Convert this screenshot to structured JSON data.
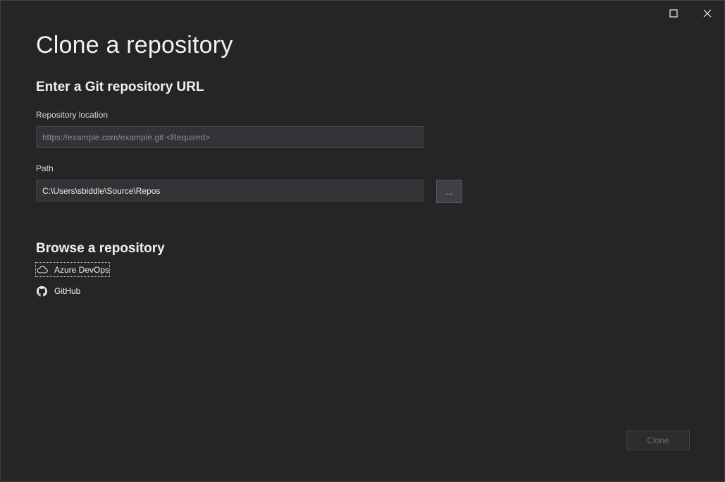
{
  "dialog": {
    "title": "Clone a repository"
  },
  "url_section": {
    "heading": "Enter a Git repository URL",
    "repo_location": {
      "label": "Repository location",
      "placeholder": "https://example.com/example.git <Required>",
      "value": ""
    },
    "path": {
      "label": "Path",
      "value": "C:\\Users\\sbiddle\\Source\\Repos",
      "browse_label": "..."
    }
  },
  "browse_section": {
    "heading": "Browse a repository",
    "providers": [
      {
        "label": "Azure DevOps",
        "icon": "cloud-icon"
      },
      {
        "label": "GitHub",
        "icon": "github-icon"
      }
    ]
  },
  "footer": {
    "clone_label": "Clone"
  },
  "colors": {
    "background": "#252526",
    "input_background": "#333337",
    "text": "#f1f1f1",
    "disabled_text": "#6d6d6d"
  }
}
